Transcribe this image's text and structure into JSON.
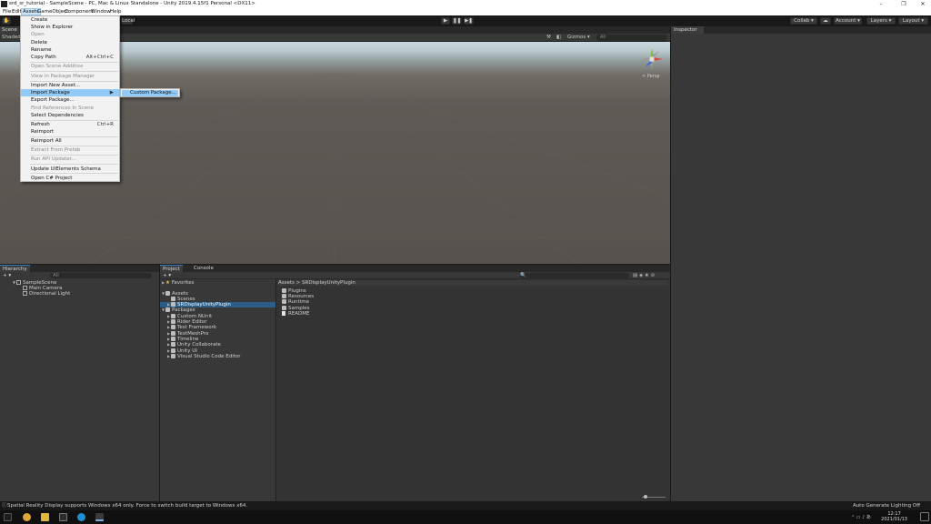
{
  "window": {
    "title": "srd_sr_tutorial - SampleScene - PC, Mac & Linux Standalone - Unity 2019.4.15f1 Personal <DX11>",
    "minimize": "–",
    "maximize": "❐",
    "close": "✕"
  },
  "menubar": [
    "File",
    "Edit",
    "Assets",
    "GameObject",
    "Component",
    "Window",
    "Help"
  ],
  "toolbar": {
    "local": "Local",
    "collab": "Collab ▾",
    "account": "Account ▾",
    "layers": "Layers ▾",
    "layout": "Layout ▾",
    "play": "▶",
    "pause": "❚❚",
    "step": "▶❚"
  },
  "scene": {
    "tab": "Scene",
    "shading": "Shaded",
    "gizmos": "Gizmos ▾",
    "search_placeholder": "All",
    "persp": "< Persp"
  },
  "inspector": {
    "tab": "Inspector"
  },
  "assets_menu": {
    "items": [
      {
        "label": "Create",
        "enabled": true
      },
      {
        "label": "Show in Explorer",
        "enabled": true
      },
      {
        "label": "Open",
        "enabled": false
      },
      {
        "label": "Delete",
        "enabled": true
      },
      {
        "label": "Rename",
        "enabled": true
      },
      {
        "label": "Copy Path",
        "enabled": true,
        "shortcut": "Alt+Ctrl+C"
      },
      {
        "label": "Open Scene Additive",
        "enabled": false
      },
      {
        "label": "View in Package Manager",
        "enabled": false
      },
      {
        "label": "Import New Asset...",
        "enabled": true
      },
      {
        "label": "Import Package",
        "enabled": true
      },
      {
        "label": "Export Package...",
        "enabled": true
      },
      {
        "label": "Find References In Scene",
        "enabled": false
      },
      {
        "label": "Select Dependencies",
        "enabled": true
      },
      {
        "label": "Refresh",
        "enabled": true,
        "shortcut": "Ctrl+R"
      },
      {
        "label": "Reimport",
        "enabled": true
      },
      {
        "label": "Reimport All",
        "enabled": true
      },
      {
        "label": "Extract From Prefab",
        "enabled": false
      },
      {
        "label": "Run API Updater...",
        "enabled": false
      },
      {
        "label": "Update UIElements Schema",
        "enabled": true
      },
      {
        "label": "Open C# Project",
        "enabled": true
      }
    ],
    "submenu_item": "Custom Package..."
  },
  "hierarchy": {
    "tab": "Hierarchy",
    "search_placeholder": "All",
    "scene": "SampleScene",
    "objects": [
      "Main Camera",
      "Directional Light"
    ]
  },
  "project": {
    "tab": "Project",
    "console_tab": "Console",
    "favorites": "Favorites",
    "assets": "Assets",
    "asset_children": [
      "Scenes",
      "SRDisplayUnityPlugin"
    ],
    "packages": "Packages",
    "package_children": [
      "Custom NUnit",
      "Rider Editor",
      "Test Framework",
      "TextMeshPro",
      "Timeline",
      "Unity Collaborate",
      "Unity UI",
      "Visual Studio Code Editor"
    ],
    "breadcrumb_root": "Assets",
    "breadcrumb_sep": ">",
    "breadcrumb_current": "SRDisplayUnityPlugin",
    "contents": [
      "Plugins",
      "Resources",
      "Runtime",
      "Samples",
      "README"
    ]
  },
  "status": {
    "message": "Spatial Reality Display supports Windows x64 only. Force to switch build target to Windows x64.",
    "right": "Auto Generate Lighting Off"
  },
  "taskbar": {
    "time": "12:17",
    "date": "2021/01/13"
  }
}
